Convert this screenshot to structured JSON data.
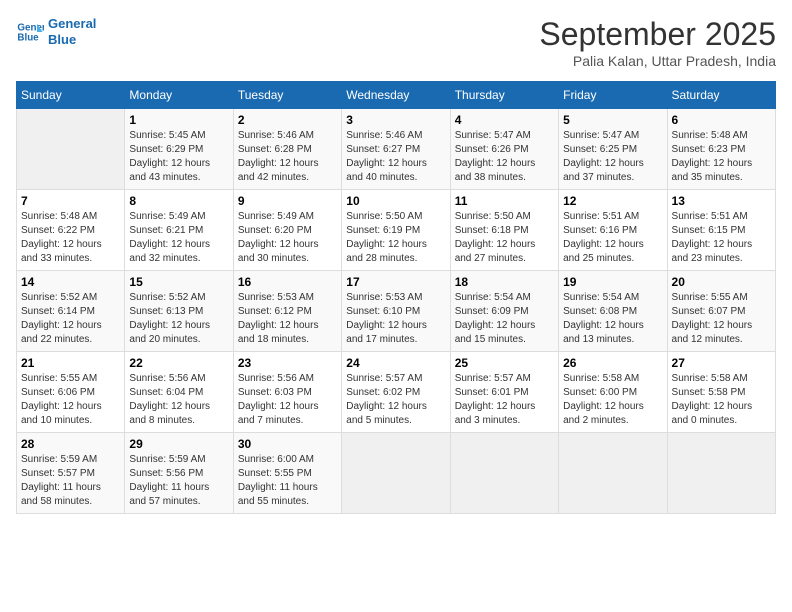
{
  "header": {
    "logo_line1": "General",
    "logo_line2": "Blue",
    "month_title": "September 2025",
    "subtitle": "Palia Kalan, Uttar Pradesh, India"
  },
  "weekdays": [
    "Sunday",
    "Monday",
    "Tuesday",
    "Wednesday",
    "Thursday",
    "Friday",
    "Saturday"
  ],
  "weeks": [
    [
      {
        "day": "",
        "info": ""
      },
      {
        "day": "1",
        "info": "Sunrise: 5:45 AM\nSunset: 6:29 PM\nDaylight: 12 hours\nand 43 minutes."
      },
      {
        "day": "2",
        "info": "Sunrise: 5:46 AM\nSunset: 6:28 PM\nDaylight: 12 hours\nand 42 minutes."
      },
      {
        "day": "3",
        "info": "Sunrise: 5:46 AM\nSunset: 6:27 PM\nDaylight: 12 hours\nand 40 minutes."
      },
      {
        "day": "4",
        "info": "Sunrise: 5:47 AM\nSunset: 6:26 PM\nDaylight: 12 hours\nand 38 minutes."
      },
      {
        "day": "5",
        "info": "Sunrise: 5:47 AM\nSunset: 6:25 PM\nDaylight: 12 hours\nand 37 minutes."
      },
      {
        "day": "6",
        "info": "Sunrise: 5:48 AM\nSunset: 6:23 PM\nDaylight: 12 hours\nand 35 minutes."
      }
    ],
    [
      {
        "day": "7",
        "info": "Sunrise: 5:48 AM\nSunset: 6:22 PM\nDaylight: 12 hours\nand 33 minutes."
      },
      {
        "day": "8",
        "info": "Sunrise: 5:49 AM\nSunset: 6:21 PM\nDaylight: 12 hours\nand 32 minutes."
      },
      {
        "day": "9",
        "info": "Sunrise: 5:49 AM\nSunset: 6:20 PM\nDaylight: 12 hours\nand 30 minutes."
      },
      {
        "day": "10",
        "info": "Sunrise: 5:50 AM\nSunset: 6:19 PM\nDaylight: 12 hours\nand 28 minutes."
      },
      {
        "day": "11",
        "info": "Sunrise: 5:50 AM\nSunset: 6:18 PM\nDaylight: 12 hours\nand 27 minutes."
      },
      {
        "day": "12",
        "info": "Sunrise: 5:51 AM\nSunset: 6:16 PM\nDaylight: 12 hours\nand 25 minutes."
      },
      {
        "day": "13",
        "info": "Sunrise: 5:51 AM\nSunset: 6:15 PM\nDaylight: 12 hours\nand 23 minutes."
      }
    ],
    [
      {
        "day": "14",
        "info": "Sunrise: 5:52 AM\nSunset: 6:14 PM\nDaylight: 12 hours\nand 22 minutes."
      },
      {
        "day": "15",
        "info": "Sunrise: 5:52 AM\nSunset: 6:13 PM\nDaylight: 12 hours\nand 20 minutes."
      },
      {
        "day": "16",
        "info": "Sunrise: 5:53 AM\nSunset: 6:12 PM\nDaylight: 12 hours\nand 18 minutes."
      },
      {
        "day": "17",
        "info": "Sunrise: 5:53 AM\nSunset: 6:10 PM\nDaylight: 12 hours\nand 17 minutes."
      },
      {
        "day": "18",
        "info": "Sunrise: 5:54 AM\nSunset: 6:09 PM\nDaylight: 12 hours\nand 15 minutes."
      },
      {
        "day": "19",
        "info": "Sunrise: 5:54 AM\nSunset: 6:08 PM\nDaylight: 12 hours\nand 13 minutes."
      },
      {
        "day": "20",
        "info": "Sunrise: 5:55 AM\nSunset: 6:07 PM\nDaylight: 12 hours\nand 12 minutes."
      }
    ],
    [
      {
        "day": "21",
        "info": "Sunrise: 5:55 AM\nSunset: 6:06 PM\nDaylight: 12 hours\nand 10 minutes."
      },
      {
        "day": "22",
        "info": "Sunrise: 5:56 AM\nSunset: 6:04 PM\nDaylight: 12 hours\nand 8 minutes."
      },
      {
        "day": "23",
        "info": "Sunrise: 5:56 AM\nSunset: 6:03 PM\nDaylight: 12 hours\nand 7 minutes."
      },
      {
        "day": "24",
        "info": "Sunrise: 5:57 AM\nSunset: 6:02 PM\nDaylight: 12 hours\nand 5 minutes."
      },
      {
        "day": "25",
        "info": "Sunrise: 5:57 AM\nSunset: 6:01 PM\nDaylight: 12 hours\nand 3 minutes."
      },
      {
        "day": "26",
        "info": "Sunrise: 5:58 AM\nSunset: 6:00 PM\nDaylight: 12 hours\nand 2 minutes."
      },
      {
        "day": "27",
        "info": "Sunrise: 5:58 AM\nSunset: 5:58 PM\nDaylight: 12 hours\nand 0 minutes."
      }
    ],
    [
      {
        "day": "28",
        "info": "Sunrise: 5:59 AM\nSunset: 5:57 PM\nDaylight: 11 hours\nand 58 minutes."
      },
      {
        "day": "29",
        "info": "Sunrise: 5:59 AM\nSunset: 5:56 PM\nDaylight: 11 hours\nand 57 minutes."
      },
      {
        "day": "30",
        "info": "Sunrise: 6:00 AM\nSunset: 5:55 PM\nDaylight: 11 hours\nand 55 minutes."
      },
      {
        "day": "",
        "info": ""
      },
      {
        "day": "",
        "info": ""
      },
      {
        "day": "",
        "info": ""
      },
      {
        "day": "",
        "info": ""
      }
    ]
  ]
}
